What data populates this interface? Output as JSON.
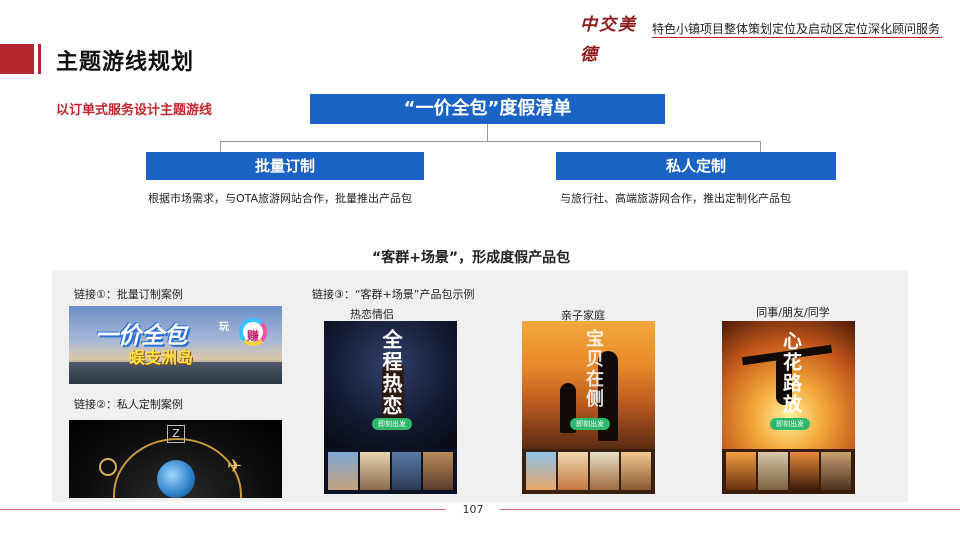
{
  "header": {
    "logo_text": "中交美德",
    "project_title": "特色小镇项目整体策划定位及启动区定位深化顾问服务"
  },
  "page_title": "主题游线规划",
  "subtitle": "以订单式服务设计主题游线",
  "diagram": {
    "main": "“一价全包”度假清单",
    "branches": [
      {
        "title": "批量订制",
        "desc": "根据市场需求，与OTA旅游网站合作，批量推出产品包"
      },
      {
        "title": "私人定制",
        "desc": "与旅行社、高端旅游网合作，推出定制化产品包"
      }
    ],
    "result": "“客群+场景”，形成度假产品包"
  },
  "cases": {
    "link1_label": "链接①：批量订制案例",
    "link2_label": "链接②：私人定制案例",
    "link3_label": "链接③：“客群+场景”产品包示例",
    "banner1": {
      "main_text": "一价全包",
      "wan": "玩",
      "zhuan": "赚",
      "place": "蜈支洲岛"
    },
    "banner2": {
      "badge": "Z"
    },
    "categories": [
      "热恋情侣",
      "亲子家庭",
      "同事/朋友/同学"
    ],
    "posters": [
      {
        "title": "全程热恋",
        "button": "即刻出发"
      },
      {
        "title": "宝贝在侧",
        "button": "即刻出发"
      },
      {
        "title": "心花路放",
        "button": "即刻出发"
      }
    ]
  },
  "footer": {
    "page_number": "107"
  },
  "colors": {
    "accent_red": "#b3262d",
    "accent_blue": "#1a63c4",
    "panel_grey": "#f0f0f0"
  }
}
